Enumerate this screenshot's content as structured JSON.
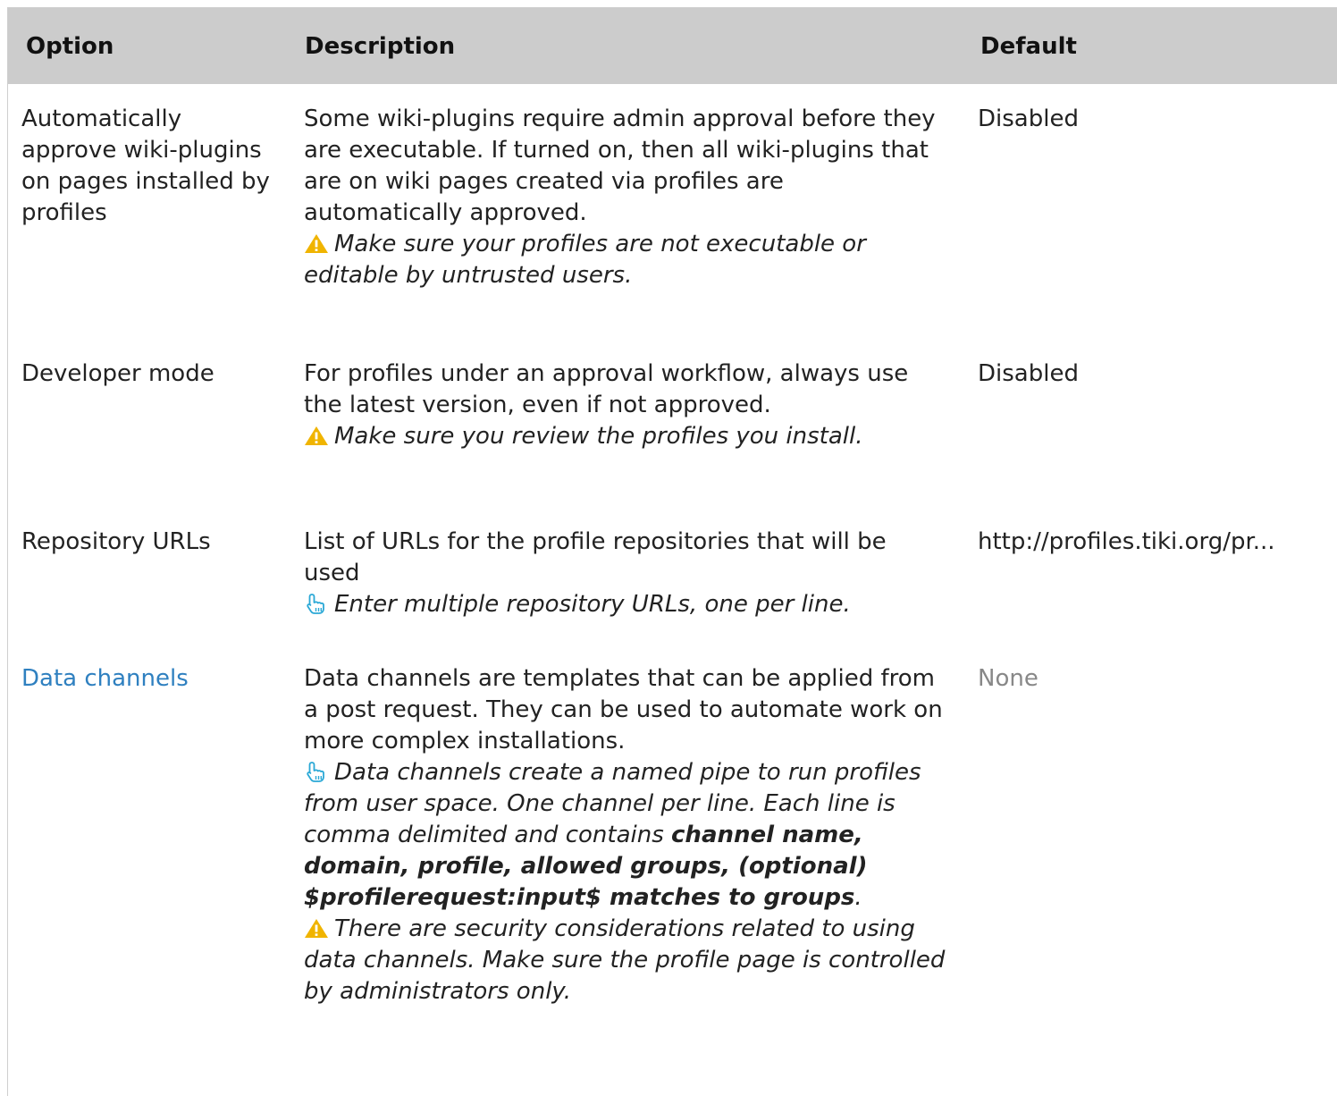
{
  "header": {
    "option": "Option",
    "description": "Description",
    "default": "Default"
  },
  "rows": [
    {
      "option": "Automatically approve wiki-plugins on pages installed by profiles",
      "description": "Some wiki-plugins require admin approval before they are executable. If turned on, then all wiki-plugins that are on wiki pages created via profiles are automatically approved.",
      "note_icon": "warning-icon",
      "note": "Make sure your profiles are not executable or editable by untrusted users.",
      "default": "Disabled"
    },
    {
      "option": "Developer mode",
      "description": "For profiles under an approval workflow, always use the latest version, even if not approved.",
      "note_icon": "warning-icon",
      "note": "Make sure you review the profiles you install.",
      "default": "Disabled"
    },
    {
      "option": "Repository URLs",
      "description": "List of URLs for the profile repositories that will be used",
      "note_icon": "pointing-hand-icon",
      "note": "Enter multiple repository URLs, one per line.",
      "default": "http://profiles.tiki.org/pr..."
    },
    {
      "option": "Data channels",
      "description": "Data channels are templates that can be applied from a post request. They can be used to automate work on more complex installations.",
      "tip_icon": "pointing-hand-icon",
      "tip_text": "Data channels create a named pipe to run profiles from user space. One channel per line. Each line is comma delimited and contains",
      "tip_bold": "channel name, domain, profile, allowed groups, (optional) $profilerequest:input$ matches to groups",
      "tip_end": ".",
      "warning_icon": "warning-icon",
      "warning": "There are security considerations related to using data channels. Make sure the profile page is controlled by administrators only.",
      "default": "None"
    }
  ],
  "colors": {
    "header_bg": "#cccccc",
    "link": "#2f80c0",
    "warning_icon": "#f0b400",
    "hand_icon": "#2aa8d6",
    "muted": "#888888"
  }
}
